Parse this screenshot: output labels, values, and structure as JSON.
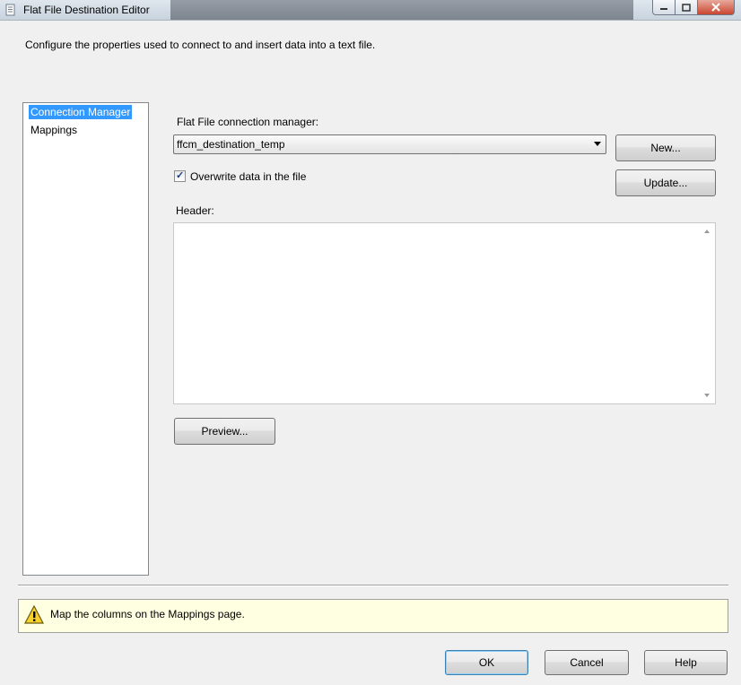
{
  "window": {
    "title": "Flat File Destination Editor",
    "minimize_icon": "minimize-icon",
    "maximize_icon": "maximize-icon",
    "close_icon": "close-icon"
  },
  "description": "Configure the properties used to connect to and insert data into a text file.",
  "nav": {
    "items": [
      {
        "label": "Connection Manager",
        "selected": true
      },
      {
        "label": "Mappings",
        "selected": false
      }
    ]
  },
  "connection": {
    "label": "Flat File connection manager:",
    "selected_value": "ffcm_destination_temp",
    "new_button": "New...",
    "update_button": "Update..."
  },
  "overwrite": {
    "label": "Overwrite data in the file",
    "checked": true
  },
  "header": {
    "label": "Header:",
    "value": ""
  },
  "preview_button": "Preview...",
  "warning": {
    "icon": "warning-icon",
    "text": "Map the columns on the Mappings page."
  },
  "footer": {
    "ok": "OK",
    "cancel": "Cancel",
    "help": "Help"
  },
  "colors": {
    "selection": "#3399ff",
    "warning_bg": "#ffffe1",
    "dialog_bg": "#f0f0f0"
  }
}
